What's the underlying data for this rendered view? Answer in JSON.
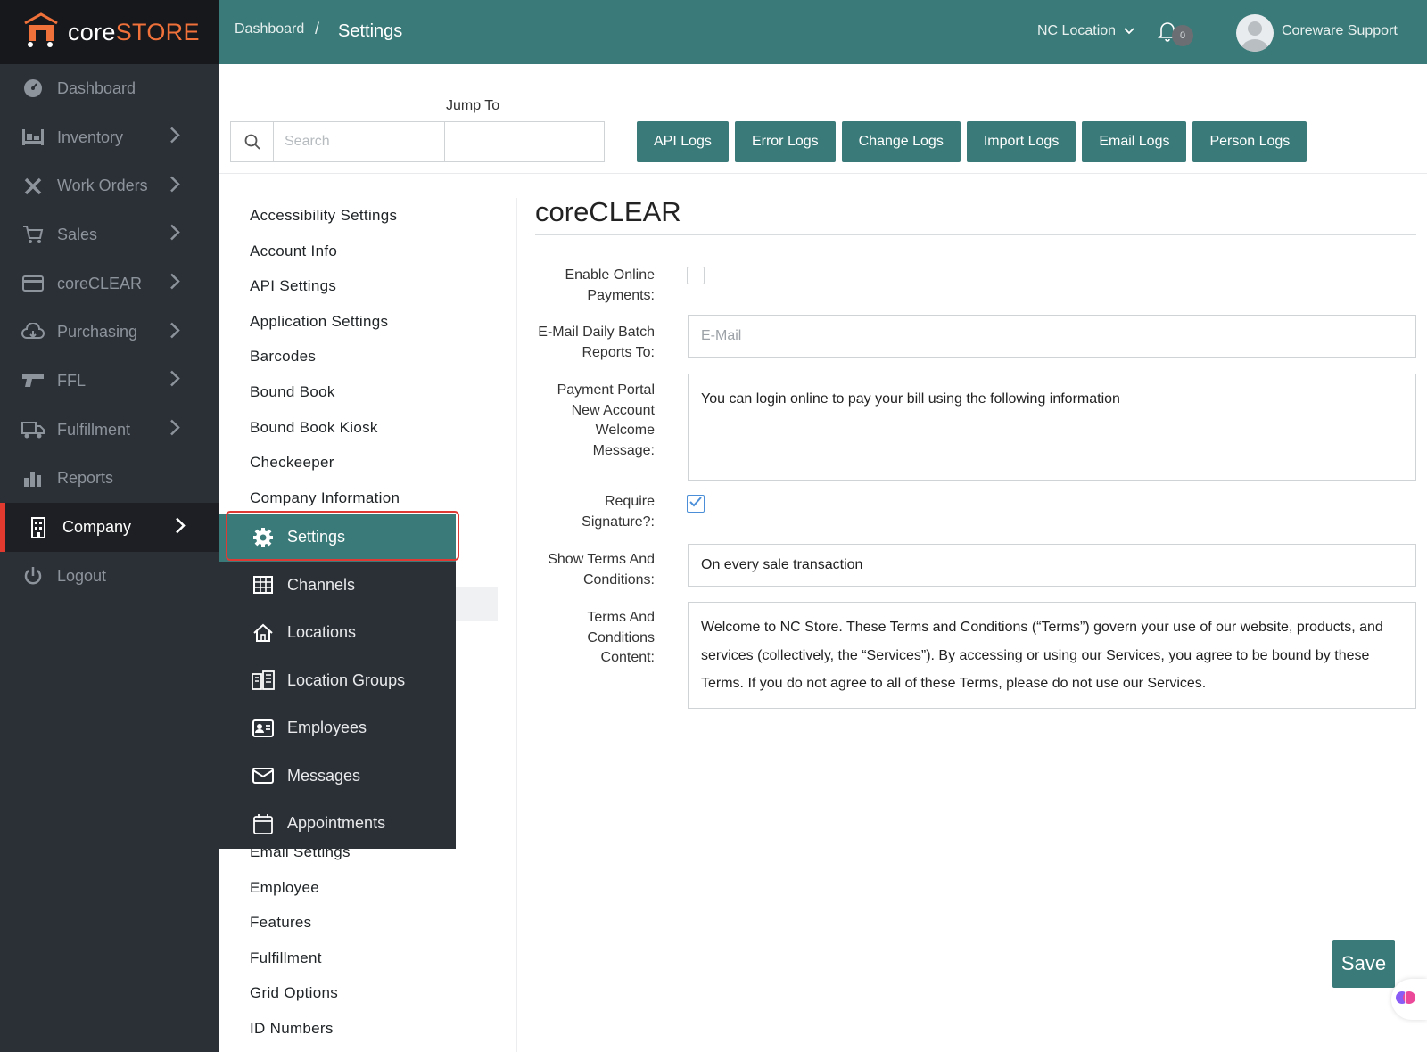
{
  "app": {
    "logo_core": "core",
    "logo_store": "STORE",
    "brand_color": "#3a7a78",
    "accent_color": "#f0713a"
  },
  "header": {
    "breadcrumb_root": "Dashboard",
    "breadcrumb_sep": "/",
    "breadcrumb_current": "Settings",
    "location": "NC Location",
    "notifications_count": "0",
    "user_name": "Coreware Support"
  },
  "sidebar": {
    "items": [
      {
        "label": "Dashboard",
        "icon": "dashboard-icon"
      },
      {
        "label": "Inventory",
        "icon": "inventory-icon"
      },
      {
        "label": "Work Orders",
        "icon": "tools-icon"
      },
      {
        "label": "Sales",
        "icon": "cart-icon"
      },
      {
        "label": "coreCLEAR",
        "icon": "credit-card-icon"
      },
      {
        "label": "Purchasing",
        "icon": "cloud-download-icon"
      },
      {
        "label": "FFL",
        "icon": "gun-icon"
      },
      {
        "label": "Fulfillment",
        "icon": "truck-icon"
      },
      {
        "label": "Reports",
        "icon": "bar-chart-icon"
      },
      {
        "label": "Company",
        "icon": "building-icon"
      },
      {
        "label": "Logout",
        "icon": "power-icon"
      }
    ]
  },
  "toolbar": {
    "jump_to_label": "Jump To",
    "search_placeholder": "Search",
    "log_buttons": [
      "API Logs",
      "Error Logs",
      "Change Logs",
      "Import Logs",
      "Email Logs",
      "Person Logs"
    ]
  },
  "settings_list": {
    "top": [
      "Accessibility Settings",
      "Account Info",
      "API Settings",
      "Application Settings",
      "Barcodes",
      "Bound Book",
      "Bound Book Kiosk",
      "Checkeeper",
      "Company Information"
    ],
    "bottom": [
      "Email Settings",
      "Employee",
      "Features",
      "Fulfillment",
      "Grid Options",
      "ID Numbers"
    ]
  },
  "company_flyout": {
    "items": [
      {
        "label": "Settings",
        "icon": "gear-icon"
      },
      {
        "label": "Channels",
        "icon": "grid-icon"
      },
      {
        "label": "Locations",
        "icon": "home-icon"
      },
      {
        "label": "Location Groups",
        "icon": "buildings-icon"
      },
      {
        "label": "Employees",
        "icon": "id-card-icon"
      },
      {
        "label": "Messages",
        "icon": "envelope-icon"
      },
      {
        "label": "Appointments",
        "icon": "calendar-icon"
      }
    ]
  },
  "form": {
    "section_title": "coreCLEAR",
    "enable_online_payments_label": "Enable Online Payments:",
    "enable_online_payments_checked": false,
    "email_daily_label": "E-Mail Daily Batch Reports To:",
    "email_daily_placeholder": "E-Mail",
    "payment_portal_label": "Payment Portal New Account Welcome Message:",
    "payment_portal_value": "You can login online to pay your bill using the following information",
    "require_signature_label": "Require Signature?:",
    "require_signature_checked": true,
    "show_terms_label": "Show Terms And Conditions:",
    "show_terms_value": "On every sale transaction",
    "terms_content_label": "Terms And Conditions Content:",
    "terms_content_value": "Welcome to NC Store. These Terms and Conditions (“Terms”) govern your use of our website, products, and services (collectively, the “Services”). By accessing or using our Services, you agree to be bound by these Terms. If you do not agree to all of these Terms, please do not use our Services.",
    "save_label": "Save"
  }
}
